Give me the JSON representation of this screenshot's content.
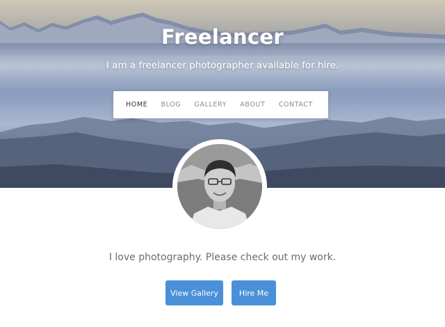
{
  "site": {
    "title": "Freelancer",
    "tagline": "I am a freelancer photographer available for hire."
  },
  "nav": {
    "items": [
      {
        "label": "HOME",
        "active": true
      },
      {
        "label": "BLOG",
        "active": false
      },
      {
        "label": "GALLERY",
        "active": false
      },
      {
        "label": "ABOUT",
        "active": false
      },
      {
        "label": "CONTACT",
        "active": false
      }
    ]
  },
  "main": {
    "intro": "I love photography. Please check out my work.",
    "buttons": {
      "gallery_label": "View Gallery",
      "hire_label": "Hire Me"
    }
  },
  "colors": {
    "accent": "#4a90d9",
    "text_muted": "#6b6b6b"
  }
}
